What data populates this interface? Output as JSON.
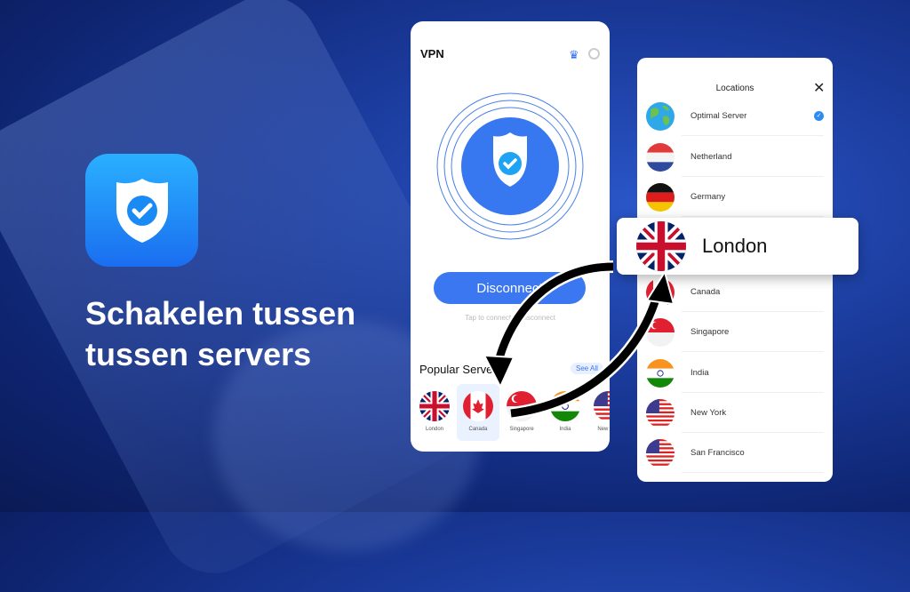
{
  "headline": {
    "line1": "Schakelen tussen",
    "line2": "tussen servers"
  },
  "phone": {
    "title": "VPN",
    "crown_icon": "crown-icon",
    "settings_icon": "gear-icon",
    "disconnect_label": "Disconnect",
    "hint": "Tap to connect or disconnect",
    "popular_title": "Popular Servers",
    "see_all": "See All",
    "servers": [
      {
        "label": "London",
        "flag": "uk"
      },
      {
        "label": "Canada",
        "flag": "ca",
        "selected": true
      },
      {
        "label": "Singapore",
        "flag": "sg"
      },
      {
        "label": "India",
        "flag": "in"
      },
      {
        "label": "New York",
        "flag": "us"
      }
    ]
  },
  "locations": {
    "title": "Locations",
    "items": [
      {
        "label": "Optimal Server",
        "flag": "globe",
        "selected": true
      },
      {
        "label": "Netherland",
        "flag": "nl"
      },
      {
        "label": "Germany",
        "flag": "de"
      },
      {
        "label": "Canada",
        "flag": "ca"
      },
      {
        "label": "Singapore",
        "flag": "sg"
      },
      {
        "label": "India",
        "flag": "in"
      },
      {
        "label": "New York",
        "flag": "us"
      },
      {
        "label": "San Francisco",
        "flag": "us"
      }
    ]
  },
  "popup": {
    "label": "London",
    "flag": "uk"
  },
  "colors": {
    "accent": "#3a77f0",
    "background": "#1a3a9a"
  }
}
